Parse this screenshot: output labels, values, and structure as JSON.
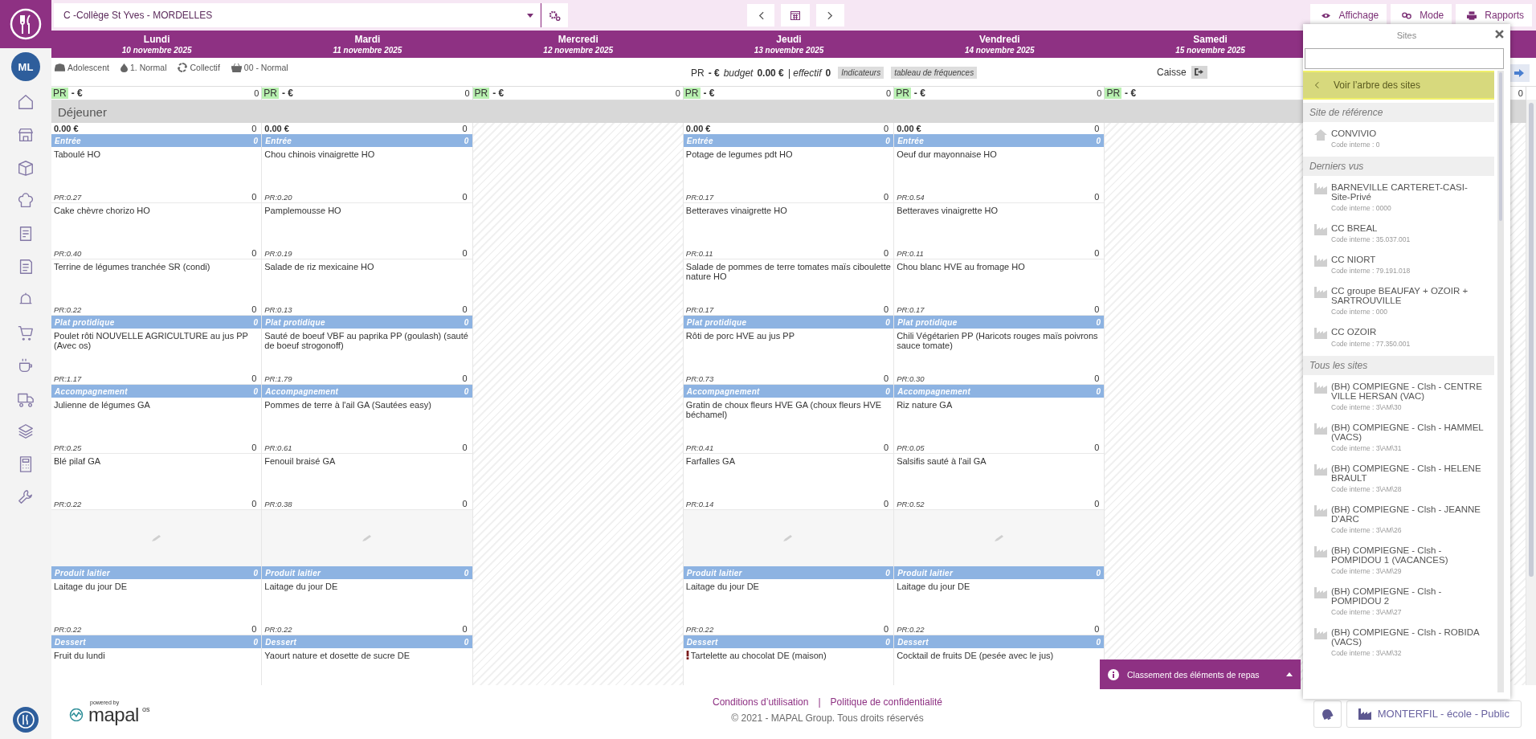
{
  "topbar": {
    "site": "C -Collège St Yves - MORDELLES",
    "buttons": [
      {
        "label": "Affichage"
      },
      {
        "label": "Mode"
      },
      {
        "label": "Rapports"
      }
    ]
  },
  "user": {
    "initials": "ML"
  },
  "days": [
    {
      "name": "Lundi",
      "date": "10 novembre 2025"
    },
    {
      "name": "Mardi",
      "date": "11 novembre 2025"
    },
    {
      "name": "Mercredi",
      "date": "12 novembre 2025"
    },
    {
      "name": "Jeudi",
      "date": "13 novembre 2025"
    },
    {
      "name": "Vendredi",
      "date": "14 novembre 2025"
    },
    {
      "name": "Samedi",
      "date": "15 novembre 2025"
    }
  ],
  "filters": [
    {
      "label": "Adolescent"
    },
    {
      "label": "1. Normal"
    },
    {
      "label": "Collectif"
    },
    {
      "label": "00 - Normal"
    }
  ],
  "summary": {
    "pr": "PR",
    "pr_value": "- €",
    "budget_label": "budget",
    "budget": "0.00 €",
    "effectif_label": "| effectif",
    "effectif": "0",
    "buttons": [
      "Indicateurs",
      "tableau de fréquences"
    ],
    "caisse": "Caisse"
  },
  "pr_row": [
    {
      "label": "PR",
      "value": "- €",
      "count": "0"
    },
    {
      "label": "PR",
      "value": "- €",
      "count": "0"
    },
    {
      "label": "PR",
      "value": "- €",
      "count": "0"
    },
    {
      "label": "PR",
      "value": "- €",
      "count": "0"
    },
    {
      "label": "PR",
      "value": "- €",
      "count": "0"
    },
    {
      "label": "PR",
      "value": "- €"
    }
  ],
  "column_7": {
    "count": "0"
  },
  "meal": {
    "label": "Déjeuner",
    "columns": [
      {
        "empty": false,
        "total": "0.00 €",
        "count": "0",
        "sections": [
          {
            "kind": "category",
            "name": "Entrée",
            "count": "0",
            "dishes": [
              {
                "name": "Taboulé HO",
                "pr": "PR:0.27",
                "count": "0"
              },
              {
                "name": "Cake chèvre chorizo HO",
                "pr": "PR:0.40",
                "count": "0"
              },
              {
                "name": "Terrine de légumes tranchée SR (condi)",
                "pr": "PR:0.22",
                "count": "0"
              }
            ]
          },
          {
            "kind": "category",
            "name": "Plat protidique",
            "count": "0",
            "dishes": [
              {
                "name": "Poulet rôti NOUVELLE AGRICULTURE au jus PP (Avec os)",
                "pr": "PR:1.17",
                "count": "0"
              }
            ]
          },
          {
            "kind": "category",
            "name": "Accompagnement",
            "count": "0",
            "dishes": [
              {
                "name": "Julienne de légumes GA",
                "pr": "PR:0.25",
                "count": "0"
              },
              {
                "name": "Blé pilaf GA",
                "pr": "PR:0.22",
                "count": "0"
              }
            ]
          },
          {
            "kind": "blank"
          },
          {
            "kind": "category",
            "name": "Produit laitier",
            "count": "0",
            "dishes": [
              {
                "name": "Laitage du jour DE",
                "pr": "PR:0.22",
                "count": "0"
              }
            ]
          },
          {
            "kind": "category",
            "name": "Dessert",
            "count": "0",
            "dishes": [
              {
                "name": "Fruit du lundi"
              }
            ]
          }
        ]
      },
      {
        "empty": false,
        "total": "0.00 €",
        "count": "0",
        "sections": [
          {
            "kind": "category",
            "name": "Entrée",
            "count": "0",
            "dishes": [
              {
                "name": "Chou chinois vinaigrette HO",
                "pr": "PR:0.20",
                "count": "0"
              },
              {
                "name": "Pamplemousse HO",
                "pr": "PR:0.19",
                "count": "0"
              },
              {
                "name": "Salade de riz mexicaine HO",
                "pr": "PR:0.13",
                "count": "0"
              }
            ]
          },
          {
            "kind": "category",
            "name": "Plat protidique",
            "count": "0",
            "dishes": [
              {
                "name": "Sauté de boeuf VBF au paprika PP (goulash) (sauté de boeuf strogonoff)",
                "pr": "PR:1.79",
                "count": "0"
              }
            ]
          },
          {
            "kind": "category",
            "name": "Accompagnement",
            "count": "0",
            "dishes": [
              {
                "name": "Pommes de terre à l'ail GA (Sautées easy)",
                "pr": "PR:0.61",
                "count": "0"
              },
              {
                "name": "Fenouil braisé GA",
                "pr": "PR:0.38",
                "count": "0"
              }
            ]
          },
          {
            "kind": "blank"
          },
          {
            "kind": "category",
            "name": "Produit laitier",
            "count": "0",
            "dishes": [
              {
                "name": "Laitage du jour DE",
                "pr": "PR:0.22",
                "count": "0"
              }
            ]
          },
          {
            "kind": "category",
            "name": "Dessert",
            "count": "0",
            "dishes": [
              {
                "name": "Yaourt nature et dosette de sucre DE"
              }
            ]
          }
        ]
      },
      {
        "empty": true
      },
      {
        "empty": false,
        "total": "0.00 €",
        "count": "0",
        "sections": [
          {
            "kind": "category",
            "name": "Entrée",
            "count": "0",
            "dishes": [
              {
                "name": "Potage de legumes pdt HO",
                "pr": "PR:0.17",
                "count": "0"
              },
              {
                "name": "Betteraves vinaigrette HO",
                "pr": "PR:0.11",
                "count": "0"
              },
              {
                "name": "Salade de pommes de terre tomates maïs ciboulette nature HO",
                "pr": "PR:0.17",
                "count": "0"
              }
            ]
          },
          {
            "kind": "category",
            "name": "Plat protidique",
            "count": "0",
            "dishes": [
              {
                "name": "Rôti de porc HVE au jus PP",
                "pr": "PR:0.73",
                "count": "0"
              }
            ]
          },
          {
            "kind": "category",
            "name": "Accompagnement",
            "count": "0",
            "dishes": [
              {
                "name": "Gratin de choux fleurs HVE GA (choux fleurs HVE béchamel)",
                "pr": "PR:0.41",
                "count": "0"
              },
              {
                "name": "Farfalles GA",
                "pr": "PR:0.14",
                "count": "0"
              }
            ]
          },
          {
            "kind": "blank"
          },
          {
            "kind": "category",
            "name": "Produit laitier",
            "count": "0",
            "dishes": [
              {
                "name": "Laitage du jour DE",
                "pr": "PR:0.22",
                "count": "0"
              }
            ]
          },
          {
            "kind": "category",
            "name": "Dessert",
            "count": "0",
            "dishes": [
              {
                "name": "Tartelette au chocolat DE (maison)",
                "alert": true
              }
            ]
          }
        ]
      },
      {
        "empty": false,
        "total": "0.00 €",
        "count": "0",
        "sections": [
          {
            "kind": "category",
            "name": "Entrée",
            "count": "0",
            "dishes": [
              {
                "name": "Oeuf dur mayonnaise HO",
                "pr": "PR:0.54",
                "count": "0"
              },
              {
                "name": "Betteraves vinaigrette HO",
                "pr": "PR:0.11",
                "count": "0"
              },
              {
                "name": "Chou blanc HVE au fromage HO",
                "pr": "PR:0.17",
                "count": "0"
              }
            ]
          },
          {
            "kind": "category",
            "name": "Plat protidique",
            "count": "0",
            "dishes": [
              {
                "name": "Chili Végétarien PP (Haricots rouges maïs poivrons sauce tomate)",
                "pr": "PR:0.30",
                "count": "0"
              }
            ]
          },
          {
            "kind": "category",
            "name": "Accompagnement",
            "count": "0",
            "dishes": [
              {
                "name": "Riz nature GA",
                "pr": "PR:0.05",
                "count": "0"
              },
              {
                "name": "Salsifis sauté à l'ail GA",
                "pr": "PR:0.52",
                "count": "0"
              }
            ]
          },
          {
            "kind": "blank"
          },
          {
            "kind": "category",
            "name": "Produit laitier",
            "count": "0",
            "dishes": [
              {
                "name": "Laitage du jour DE",
                "pr": "PR:0.22",
                "count": "0"
              }
            ]
          },
          {
            "kind": "category",
            "name": "Dessert",
            "count": "0",
            "dishes": [
              {
                "name": "Cocktail de fruits DE (pesée avec le jus)"
              }
            ]
          }
        ]
      },
      {
        "empty": true
      }
    ]
  },
  "sites_panel": {
    "title": "Sites",
    "tree_link": "Voir l’arbre des sites",
    "groups": [
      {
        "label": "Site de référence",
        "sites": [
          {
            "kind": "home",
            "name": "CONVIVIO",
            "code": "Code interne : 0"
          }
        ]
      },
      {
        "label": "Derniers vus",
        "sites": [
          {
            "kind": "factory",
            "name": "BARNEVILLE CARTERET-CASI-Site-Privé",
            "code": "Code interne : 0000"
          },
          {
            "kind": "factory",
            "name": "CC BREAL",
            "code": "Code interne : 35.037.001"
          },
          {
            "kind": "factory",
            "name": "CC NIORT",
            "code": "Code interne : 79.191.018"
          },
          {
            "kind": "factory",
            "name": "CC groupe BEAUFAY + OZOIR + SARTROUVILLE",
            "code": "Code interne : 000"
          },
          {
            "kind": "factory",
            "name": "CC OZOIR",
            "code": "Code interne : 77.350.001"
          }
        ]
      },
      {
        "label": "Tous les sites",
        "sites": [
          {
            "kind": "factory",
            "name": "(BH) COMPIEGNE - Clsh - CENTRE VILLE HERSAN (VAC)",
            "code": "Code interne : 3\\AM\\30"
          },
          {
            "kind": "factory",
            "name": "(BH) COMPIEGNE - Clsh - HAMMEL (VACS)",
            "code": "Code interne : 3\\AM\\31"
          },
          {
            "kind": "factory",
            "name": "(BH) COMPIEGNE - Clsh - HELENE BRAULT",
            "code": "Code interne : 3\\AM\\28"
          },
          {
            "kind": "factory",
            "name": "(BH) COMPIEGNE - Clsh - JEANNE D'ARC",
            "code": "Code interne : 3\\AM\\26"
          },
          {
            "kind": "factory",
            "name": "(BH) COMPIEGNE - Clsh - POMPIDOU 1 (VACANCES)",
            "code": "Code interne : 3\\AM\\29"
          },
          {
            "kind": "factory",
            "name": "(BH) COMPIEGNE - Clsh - POMPIDOU 2",
            "code": "Code interne : 3\\AM\\27"
          },
          {
            "kind": "factory",
            "name": "(BH) COMPIEGNE - Clsh - ROBIDA (VACS)",
            "code": "Code interne : 3\\AM\\32"
          }
        ]
      }
    ]
  },
  "ranking_bar": {
    "label": "Classement des éléments de repas"
  },
  "footer": {
    "powered_by": "powered by",
    "brand": "mapal",
    "brand_suffix": "os",
    "links": [
      "Conditions d’utilisation",
      "Politique de confidentialité"
    ],
    "separator": "|",
    "copyright": "© 2021 - MAPAL Group. Tous droits réservés",
    "site_button": "MONTERFIL - école - Public"
  }
}
